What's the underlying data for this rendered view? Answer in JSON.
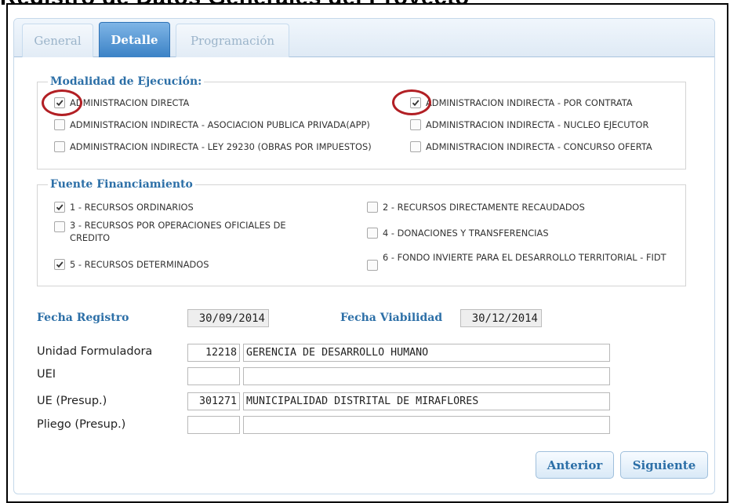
{
  "page_title": "Registro de Datos Generales del Proyecto",
  "tabs": [
    {
      "label": "General",
      "active": false
    },
    {
      "label": "Detalle",
      "active": true
    },
    {
      "label": "Programación",
      "active": false
    }
  ],
  "modalidad": {
    "legend": "Modalidad de Ejecución:",
    "options": [
      {
        "label": "ADMINISTRACION DIRECTA",
        "checked": true
      },
      {
        "label": "ADMINISTRACION INDIRECTA - POR CONTRATA",
        "checked": true
      },
      {
        "label": "ADMINISTRACION INDIRECTA - ASOCIACION PUBLICA PRIVADA(APP)",
        "checked": false
      },
      {
        "label": "ADMINISTRACION INDIRECTA - NUCLEO EJECUTOR",
        "checked": false
      },
      {
        "label": "ADMINISTRACION INDIRECTA - LEY 29230 (OBRAS POR IMPUESTOS)",
        "checked": false
      },
      {
        "label": "ADMINISTRACION INDIRECTA - CONCURSO OFERTA",
        "checked": false
      }
    ]
  },
  "fuente": {
    "legend": "Fuente Financiamiento",
    "options": [
      {
        "label": "1 - RECURSOS ORDINARIOS",
        "checked": true
      },
      {
        "label": "2 - RECURSOS DIRECTAMENTE RECAUDADOS",
        "checked": false
      },
      {
        "label": "3 - RECURSOS POR OPERACIONES OFICIALES DE CREDITO",
        "checked": false
      },
      {
        "label": "4 - DONACIONES Y TRANSFERENCIAS",
        "checked": false
      },
      {
        "label": "5 - RECURSOS DETERMINADOS",
        "checked": true
      },
      {
        "label": "6 - FONDO INVIERTE PARA EL DESARROLLO TERRITORIAL - FIDT",
        "checked": false
      }
    ]
  },
  "fechas": {
    "registro_label": "Fecha Registro",
    "registro_value": "30/09/2014",
    "viabilidad_label": "Fecha Viabilidad",
    "viabilidad_value": "30/12/2014"
  },
  "fields": [
    {
      "label": "Unidad Formuladora",
      "code": "12218",
      "name": "GERENCIA DE DESARROLLO HUMANO"
    },
    {
      "label": "UEI",
      "code": "",
      "name": ""
    },
    {
      "label": "UE (Presup.)",
      "code": "301271",
      "name": "MUNICIPALIDAD DISTRITAL DE MIRAFLORES"
    },
    {
      "label": "Pliego (Presup.)",
      "code": "",
      "name": ""
    }
  ],
  "buttons": {
    "previous": "Anterior",
    "next": "Siguiente"
  },
  "colors": {
    "accent": "#2c6fa7",
    "highlight_circle": "#b21f24",
    "active_tab": "#3b82c6"
  }
}
